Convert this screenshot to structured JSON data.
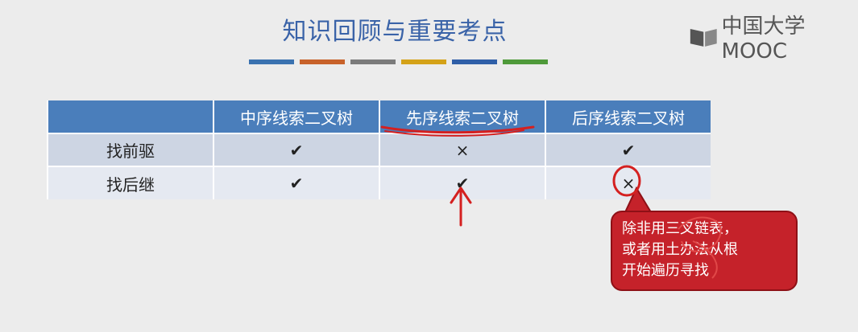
{
  "slide": {
    "title": "知识回顾与重要考点",
    "stripe_colors": [
      "#3a72b0",
      "#c8622a",
      "#7b7b7b",
      "#d4a218",
      "#2f5fa8",
      "#4f9a3a"
    ]
  },
  "logo": {
    "text": "中国大学MOOC"
  },
  "table": {
    "headers": [
      "",
      "中序线索二叉树",
      "先序线索二叉树",
      "后序线索二叉树"
    ],
    "rows": [
      {
        "label": "找前驱",
        "cells": [
          "✔",
          "×",
          "✔"
        ]
      },
      {
        "label": "找后继",
        "cells": [
          "✔",
          "✔",
          "×"
        ]
      }
    ]
  },
  "callout": {
    "lines": [
      "除非用三叉链表，",
      "或者用土办法从根",
      "开始遍历寻找"
    ]
  },
  "colors": {
    "title": "#3a63a8",
    "header_bg": "#4a7ebb",
    "callout_bg": "#c5222a",
    "annotation": "#d42020"
  }
}
